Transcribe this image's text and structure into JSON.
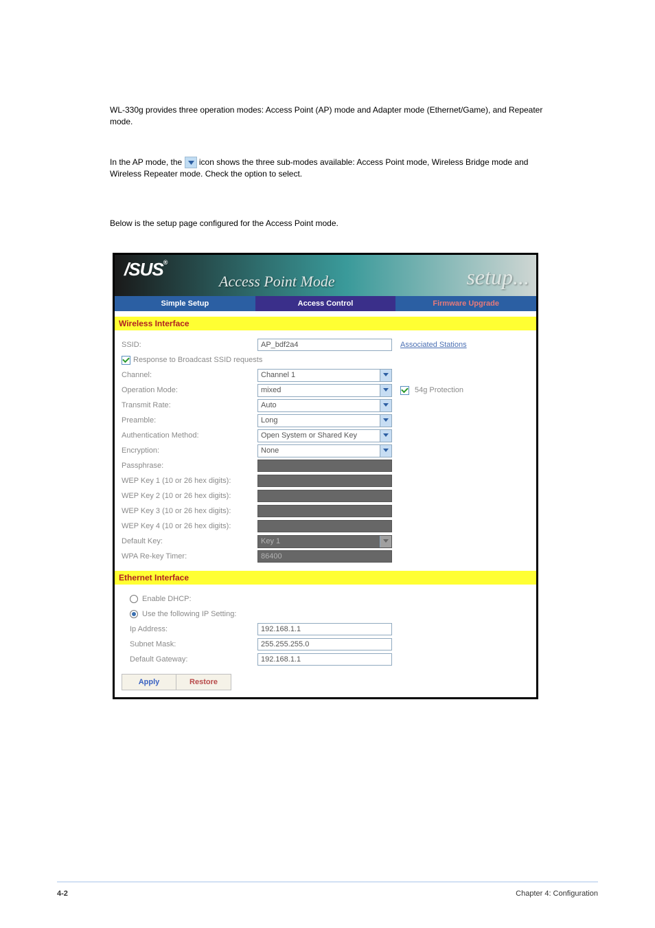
{
  "document": {
    "para1": "WL-330g provides three operation modes: Access Point (AP) mode and Adapter mode (Ethernet/Game), and Repeater mode.",
    "para2_a": "In the AP mode, the ",
    "para2_b": " icon shows the three sub-modes available: Access Point mode, Wireless Bridge mode and Wireless Repeater mode. Check the option to select.",
    "para3": "Below is the setup page configured for the Access Point mode.",
    "footer_left": "4-2",
    "footer_right": "Chapter 4: Configuration"
  },
  "screenshot": {
    "logo": "/SUS",
    "logo_reg": "®",
    "mode_text": "Access Point Mode",
    "setup_text": "setup...",
    "tabs": {
      "simple": "Simple Setup",
      "access": "Access Control",
      "fw": "Firmware Upgrade"
    },
    "section_wireless": "Wireless Interface",
    "wireless": {
      "ssid_label": "SSID:",
      "ssid_value": "AP_bdf2a4",
      "assoc_link": "Associated Stations",
      "response_label": "Response to Broadcast SSID requests",
      "channel_label": "Channel:",
      "channel_value": "Channel 1",
      "opmode_label": "Operation Mode:",
      "opmode_value": "mixed",
      "g54_label": "54g Protection",
      "txrate_label": "Transmit Rate:",
      "txrate_value": "Auto",
      "preamble_label": "Preamble:",
      "preamble_value": "Long",
      "auth_label": "Authentication Method:",
      "auth_value": "Open System or Shared Key",
      "enc_label": "Encryption:",
      "enc_value": "None",
      "pass_label": "Passphrase:",
      "wep1_label": "WEP Key 1 (10 or 26 hex digits):",
      "wep2_label": "WEP Key 2 (10 or 26 hex digits):",
      "wep3_label": "WEP Key 3 (10 or 26 hex digits):",
      "wep4_label": "WEP Key 4 (10 or 26 hex digits):",
      "defkey_label": "Default Key:",
      "defkey_value": "Key 1",
      "wpa_label": "WPA Re-key Timer:",
      "wpa_value": "86400"
    },
    "section_ethernet": "Ethernet Interface",
    "ethernet": {
      "dhcp_label": "Enable DHCP:",
      "static_label": "Use the following IP Setting:",
      "ip_label": "Ip Address:",
      "ip_value": "192.168.1.1",
      "mask_label": "Subnet Mask:",
      "mask_value": "255.255.255.0",
      "gw_label": "Default Gateway:",
      "gw_value": "192.168.1.1"
    },
    "buttons": {
      "apply": "Apply",
      "restore": "Restore"
    }
  }
}
